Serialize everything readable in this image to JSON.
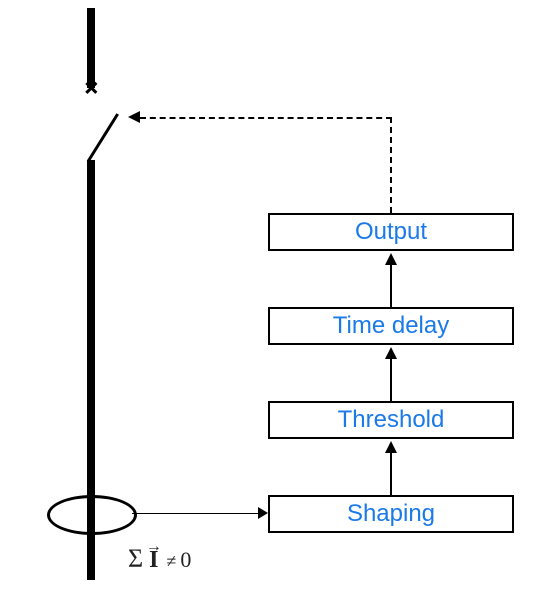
{
  "blocks": {
    "shaping": "Shaping",
    "threshold": "Threshold",
    "time_delay": "Time delay",
    "output": "Output"
  },
  "equation": {
    "sigma": "Σ",
    "vector_arrow": "→",
    "symbol_I": "I",
    "neq": "≠",
    "zero": "0"
  },
  "colors": {
    "label_blue": "#1a7ae8"
  },
  "layout_notes": {
    "description": "Ground-fault protection / earth-fault relay block diagram",
    "signal_flow": [
      "CT (ΣI≠0)",
      "Shaping",
      "Threshold",
      "Time delay",
      "Output",
      "trip breaker"
    ],
    "trip_path": "dashed line from Output to circuit-breaker"
  }
}
